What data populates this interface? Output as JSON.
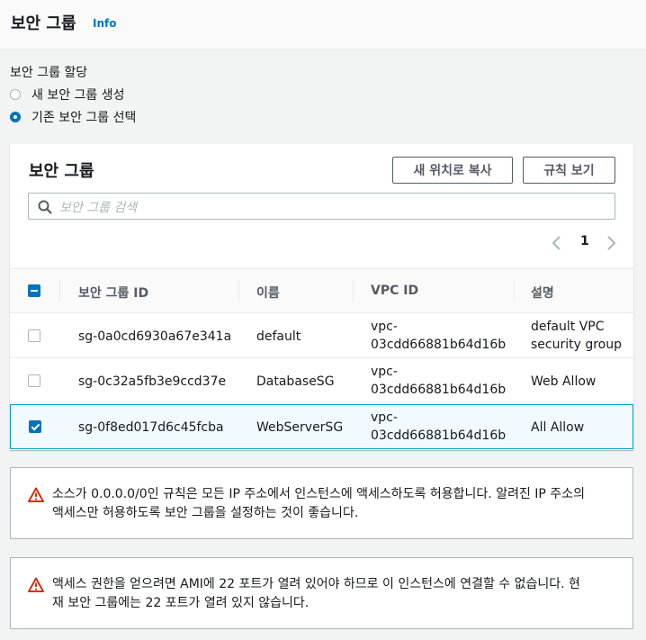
{
  "header": {
    "title": "보안 그룹",
    "info": "Info"
  },
  "assignment": {
    "label": "보안 그룹 할당",
    "options": [
      {
        "label": "새 보안 그룹 생성",
        "selected": false
      },
      {
        "label": "기존 보안 그룹 선택",
        "selected": true
      }
    ]
  },
  "panel": {
    "title": "보안 그룹",
    "copy_button": "새 위치로 복사",
    "rules_button": "규칙 보기",
    "search_placeholder": "보안 그룹 검색",
    "page": "1",
    "columns": [
      "보안 그룹 ID",
      "이름",
      "VPC ID",
      "설명"
    ],
    "rows": [
      {
        "id": "sg-0a0cd6930a67e341a",
        "name": "default",
        "vpc_line1": "vpc-",
        "vpc_line2": "03cdd66881b64d16b",
        "desc_line1": "default VPC",
        "desc_line2": "security group",
        "checked": false
      },
      {
        "id": "sg-0c32a5fb3e9ccd37e",
        "name": "DatabaseSG",
        "vpc_line1": "vpc-",
        "vpc_line2": "03cdd66881b64d16b",
        "desc_line1": "Web Allow",
        "desc_line2": "",
        "checked": false
      },
      {
        "id": "sg-0f8ed017d6c45fcba",
        "name": "WebServerSG",
        "vpc_line1": "vpc-",
        "vpc_line2": "03cdd66881b64d16b",
        "desc_line1": "All Allow",
        "desc_line2": "",
        "checked": true
      }
    ]
  },
  "alerts": [
    {
      "line1": "소스가 0.0.0.0/0인 규칙은 모든 IP 주소에서 인스턴스에 액세스하도록 허용합니다. 알려진 IP 주소의",
      "line2": "액세스만 허용하도록 보안 그룹을 설정하는 것이 좋습니다."
    },
    {
      "line1": "액세스 권한을 얻으려면 AMI에 22 포트가 열려 있어야 하므로 이 인스턴스에 연결할 수 없습니다. 현",
      "line2": "재 보안 그룹에는 22 포트가 열려 있지 않습니다."
    }
  ],
  "colors": {
    "accent": "#0073bb",
    "warning": "#d13212",
    "selected_row": "#f1faff"
  }
}
